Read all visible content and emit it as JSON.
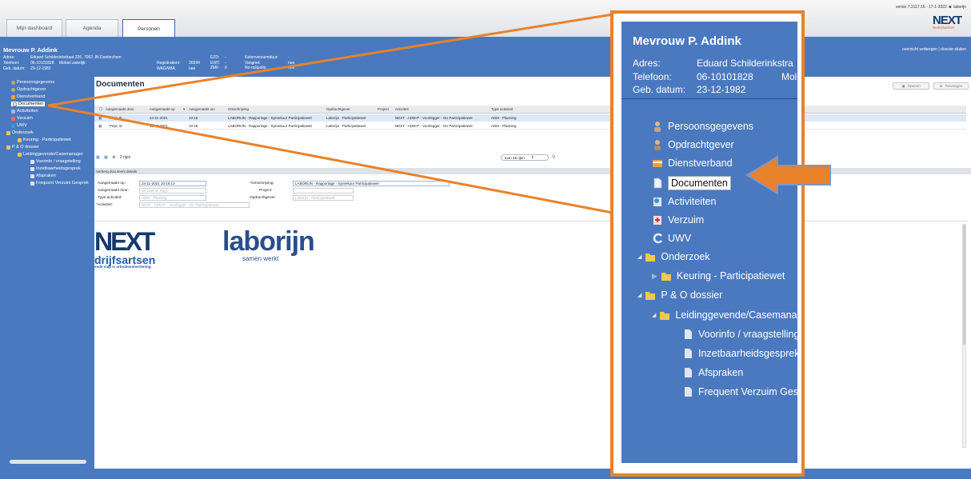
{
  "version": "versie 7.2117.16 - 17-1-2022",
  "user": "laborijn",
  "logo": {
    "main": "NEXT",
    "sub": "Bedrijfsartsen"
  },
  "tabs": [
    {
      "label": "Mijn dashboard"
    },
    {
      "label": "Agenda"
    },
    {
      "label": "Personen"
    }
  ],
  "person": {
    "name": "Mevrouw P. Addink",
    "adres_label": "Adres:",
    "adres": "Eduard Schilderinkstraat 226, 7002 JN Doetinchem",
    "adres_short": "Eduard Schilderinkstra",
    "telefoon_label": "Telefoon:",
    "telefoon": "06-10101828",
    "mobiel_label": "Mobiel zakelijk:",
    "mob_short": "Mol",
    "geb_label": "Geb. datum:",
    "geb": "23-12-1982",
    "registratienr_label": "Registratienr:",
    "registratienr": "36594",
    "wag_label": "WAG/WIA:",
    "wag": "nee",
    "ezd_label": "EZD:",
    "ezd": "-",
    "ewt_label": "EWT:",
    "ewt": "-",
    "zmf_label": "ZMF:",
    "zmf": "0",
    "keten_label": "Ketenverzuimduur:",
    "keten": "-",
    "vangnet_label": "Vangnet:",
    "vangnet": "nee",
    "norisico_label": "No-riskpolis:",
    "norisico": "nee"
  },
  "header_links": "overzicht verbergen | dossier sluiten",
  "sidebar": {
    "items": [
      {
        "label": "Persoonsgegevens",
        "icon": "person-icon"
      },
      {
        "label": "Opdrachtgever",
        "icon": "person-icon"
      },
      {
        "label": "Dienstverband",
        "icon": "contract-icon"
      },
      {
        "label": "Documenten",
        "icon": "document-icon"
      },
      {
        "label": "Activiteiten",
        "icon": "activity-icon"
      },
      {
        "label": "Verzuim",
        "icon": "absence-icon"
      },
      {
        "label": "UWV",
        "icon": "uwv-icon"
      },
      {
        "label": "Onderzoek",
        "icon": "folder-icon"
      },
      {
        "label": "Keuring - Participatiewet",
        "icon": "folder-icon"
      },
      {
        "label": "P & O dossier",
        "icon": "folder-icon"
      },
      {
        "label": "Leidinggevende/Casemanager",
        "icon": "folder-icon"
      },
      {
        "label": "Voorinfo / vraagstelling",
        "icon": "document-icon"
      },
      {
        "label": "Inzetbaarheidsgesprek",
        "icon": "document-icon"
      },
      {
        "label": "Afspraken",
        "icon": "document-icon"
      },
      {
        "label": "Frequent Verzuim Gesprek",
        "icon": "document-icon"
      }
    ],
    "zoom_items": {
      "leiding": "Leidinggevende/Casemana",
      "freq": "Frequent Verzuim Gesp"
    }
  },
  "documents": {
    "title": "Documenten",
    "open_label": "Openen",
    "add_label": "Toevoegen",
    "columns": [
      "Aangemaakt door",
      "Aangemaakt op",
      "Aangemaakt om",
      "Omschrijving",
      "Opdrachtgever",
      "Project",
      "Activiteit",
      "Type activiteit"
    ],
    "rows": [
      {
        "door": "Peijs, B.",
        "op": "24-11-2021",
        "om": "10:16",
        "omschrijving": "LABORIJN - Rapportage - Spreekuur Participatiewet",
        "opdrachtgever": "Laborijn - Participatiewet",
        "project": "",
        "activiteit": "NEXT - ADM-P - Voorlegger - SU Participatiewet",
        "type": "ADM - Planning"
      },
      {
        "door": "Peijs, B.",
        "op": "13-10-2021",
        "om": "10:46",
        "omschrijving": "LABORIJN - Rapportage - Spreekuur Participatiewet",
        "opdrachtgever": "Laborijn - Participatiewet",
        "project": "",
        "activiteit": "NEXT - ADM-P - Voorlegger - SU Participatiewet",
        "type": "ADM - Planning"
      }
    ],
    "row_count": "2 rijen",
    "pager": "toon 25 rijen"
  },
  "details": {
    "bar": "Verberg document details",
    "aangemaakt_op_label": "Aangemaakt op:",
    "aangemaakt_op": "24-11-2021 10:16:13",
    "aangemaakt_door_label": "Aangemaakt door:",
    "aangemaakt_door": "De heer B. Peijs",
    "type_label": "Type activiteit:",
    "type": "ADM - Planning",
    "activiteit_label": "Activiteit:",
    "activiteit": "NEXT - ADM-P - Voorlegger - SU Participatiewet",
    "omschrijving_label": "Omschrijving:",
    "omschrijving": "LABORIJN - Rapportage - Spreekuur Participatiewet",
    "project_label": "Project:",
    "project": "",
    "opdrachtgever_label": "Opdrachtgever:",
    "opdrachtgever": "Laborijn - Participatiewet"
  },
  "preview": {
    "next": "NEXT",
    "next_sub": "drijfsartsen",
    "next_tag": "ende stap in arbodienstverlening",
    "lab": "laborijn",
    "lab_sub": "samen werkt"
  },
  "colors": {
    "accent": "#4a79bf",
    "callout": "#e8822b"
  }
}
